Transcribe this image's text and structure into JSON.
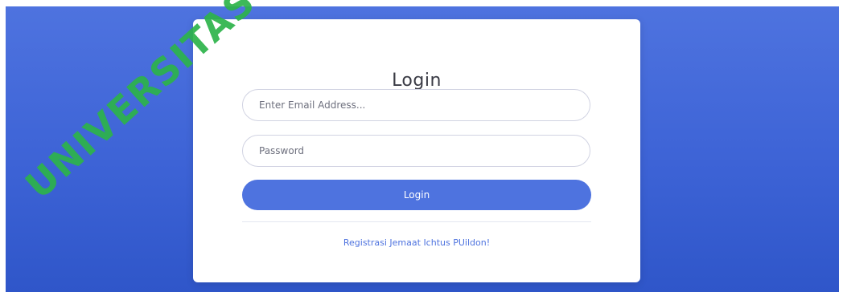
{
  "login_card": {
    "title": "Login",
    "email_placeholder": "Enter Email Address...",
    "password_placeholder": "Password",
    "login_button_label": "Login",
    "register_link_label": "Registrasi Jemaat Ichtus PUildon!"
  },
  "watermark": {
    "text": "UNIVERSITAS"
  },
  "colors": {
    "accent": "#4e73df",
    "watermark": "#2db34a"
  }
}
